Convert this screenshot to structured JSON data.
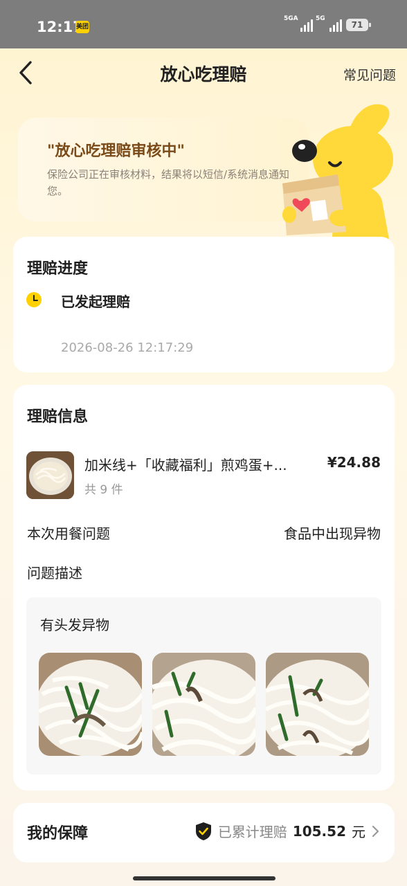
{
  "status_bar": {
    "time": "12:17",
    "app_badge": "美团",
    "signal1_label": "5GA",
    "signal2_label": "5G",
    "battery": "71"
  },
  "header": {
    "title": "放心吃理赔",
    "faq": "常见问题"
  },
  "banner": {
    "title": "\"放心吃理赔审核中\"",
    "description": "保险公司正在审核材料，结果将以短信/系统消息通知您。"
  },
  "progress": {
    "heading": "理赔进度",
    "step_label": "已发起理赔",
    "step_time": "2026-08-26 12:17:29"
  },
  "claim_info": {
    "heading": "理赔信息",
    "product_name": "加米线+「收藏福利」煎鸡蛋+...",
    "product_count": "共 9 件",
    "product_price": "¥24.88",
    "meal_issue_label": "本次用餐问题",
    "meal_issue_value": "食品中出现异物",
    "description_label": "问题描述",
    "description_text": "有头发异物"
  },
  "guarantee": {
    "label": "我的保障",
    "text": "已累计理赔",
    "amount": "105.52",
    "unit": "元"
  },
  "colors": {
    "accent_yellow": "#ffd100",
    "banner_title": "#7a4a18",
    "shield": "#1f1f1f"
  }
}
